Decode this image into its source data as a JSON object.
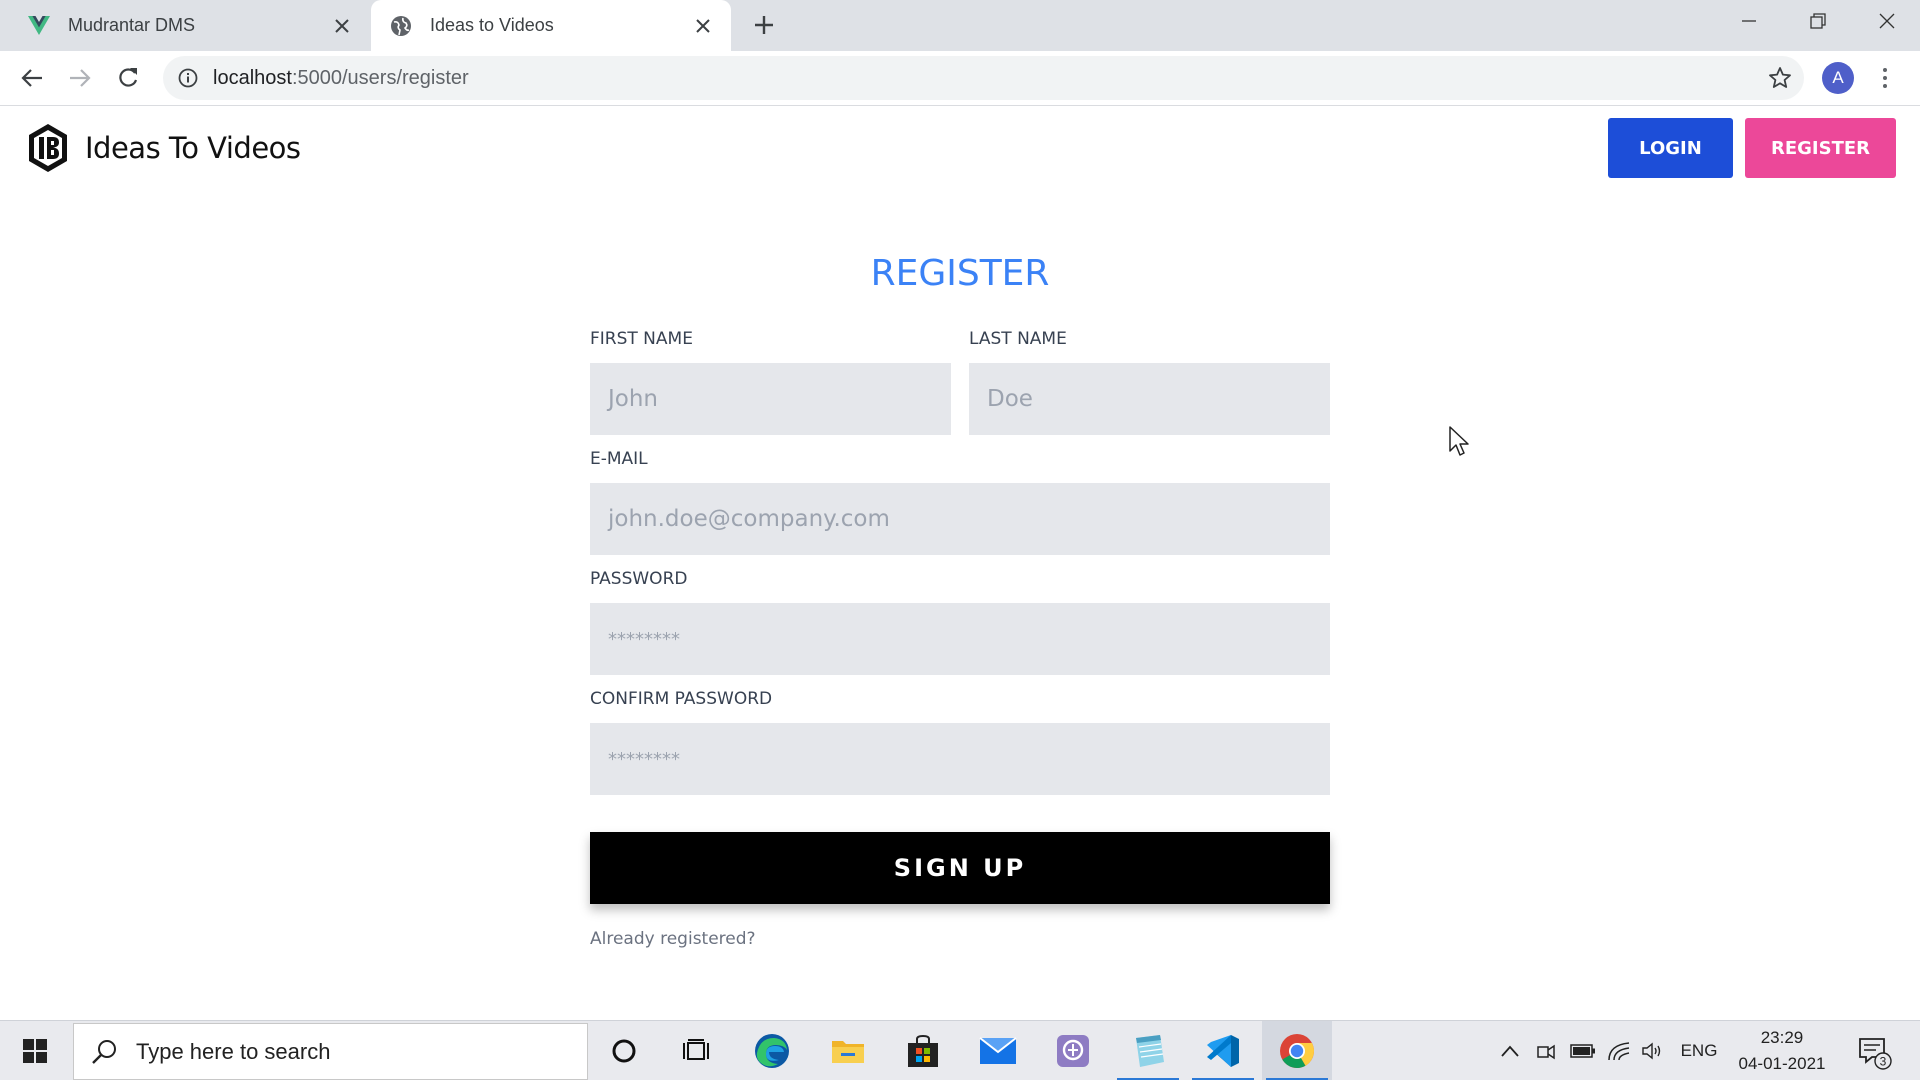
{
  "browser": {
    "tabs": [
      {
        "title": "Mudrantar DMS",
        "favicon": "vue-logo-icon",
        "active": false
      },
      {
        "title": "Ideas to Videos",
        "favicon": "globe-icon",
        "active": true
      }
    ],
    "url_host": "localhost",
    "url_path": ":5000/users/register",
    "profile_initial": "A"
  },
  "header": {
    "brand_name": "Ideas To Videos",
    "login_label": "LOGIN",
    "register_label": "REGISTER",
    "login_color": "#1d4ed8",
    "register_color": "#ec4899"
  },
  "form": {
    "title": "REGISTER",
    "title_color": "#3b82f6",
    "first_name": {
      "label": "FIRST NAME",
      "placeholder": "John"
    },
    "last_name": {
      "label": "LAST NAME",
      "placeholder": "Doe"
    },
    "email": {
      "label": "E-MAIL",
      "placeholder": "john.doe@company.com"
    },
    "password": {
      "label": "PASSWORD",
      "placeholder": "********"
    },
    "confirm_password": {
      "label": "CONFIRM PASSWORD",
      "placeholder": "********"
    },
    "submit_label": "SIGN UP",
    "already_link": "Already registered?"
  },
  "taskbar": {
    "search_placeholder": "Type here to search",
    "language": "ENG",
    "time": "23:29",
    "date": "04-01-2021",
    "notification_count": "3",
    "pinned": [
      "cortana-icon",
      "task-view-icon",
      "edge-icon",
      "file-explorer-icon",
      "store-icon",
      "mail-icon",
      "app-icon",
      "notepad-icon",
      "vscode-icon",
      "chrome-icon"
    ]
  }
}
